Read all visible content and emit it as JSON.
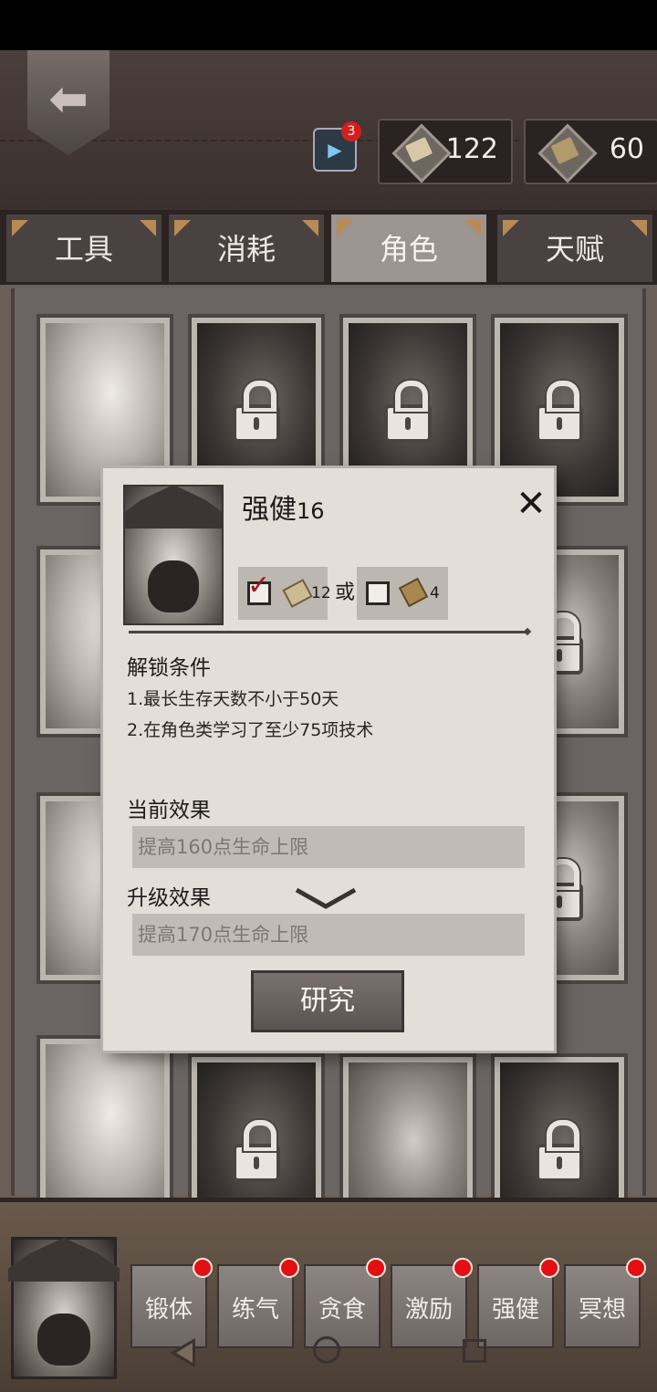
{
  "header": {
    "video_badge": "3",
    "currency_scrolls": "122",
    "currency_books": "60"
  },
  "tabs": [
    {
      "label": "工具",
      "active": false
    },
    {
      "label": "消耗",
      "active": false
    },
    {
      "label": "角色",
      "active": true
    },
    {
      "label": "天赋",
      "active": false
    }
  ],
  "dialog": {
    "title": "强健",
    "level": "16",
    "cost_option_1": {
      "amount": "12",
      "checked": true
    },
    "or_text": "或",
    "cost_option_2": {
      "amount": "4",
      "checked": false
    },
    "unlock_title": "解锁条件",
    "conditions": [
      "1.最长生存天数不小于50天",
      "2.在角色类学习了至少75项技术"
    ],
    "current_effect_title": "当前效果",
    "current_effect": "提高160点生命上限",
    "upgrade_effect_title": "升级效果",
    "upgrade_effect": "提高170点生命上限",
    "research_button": "研究",
    "close_glyph": "✕"
  },
  "skills": [
    "锻体",
    "练气",
    "贪食",
    "激励",
    "强健",
    "冥想"
  ]
}
